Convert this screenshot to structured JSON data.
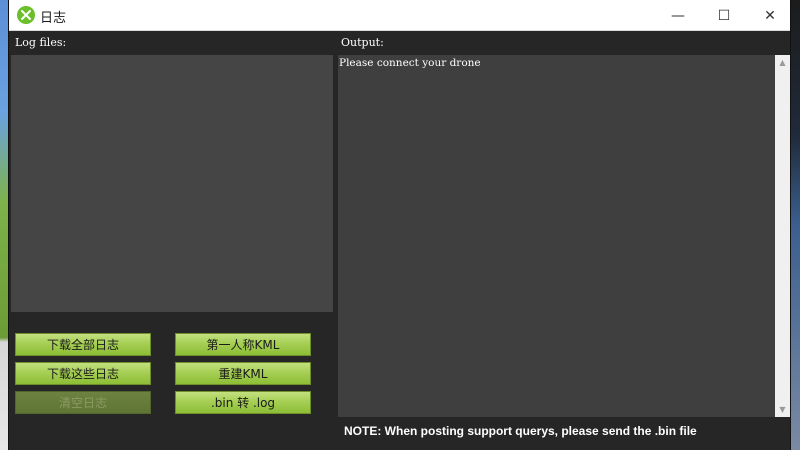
{
  "window": {
    "title": "日志",
    "controls": {
      "minimize": "—",
      "maximize": "☐",
      "close": "✕"
    }
  },
  "panels": {
    "log_files_label": "Log files:",
    "output_label": "Output:",
    "output_text": "Please connect your drone"
  },
  "buttons": {
    "download_all": "下载全部日志",
    "download_these": "下载这些日志",
    "clear_logs": "清空日志",
    "first_person_kml": "第一人称KML",
    "rebuild_kml": "重建KML",
    "bin_to_log": ".bin 转 .log"
  },
  "note": "NOTE: When posting support querys, please send the .bin file",
  "colors": {
    "accent_green": "#a6cf55",
    "panel_bg": "#262626",
    "box_bg": "#454545"
  }
}
